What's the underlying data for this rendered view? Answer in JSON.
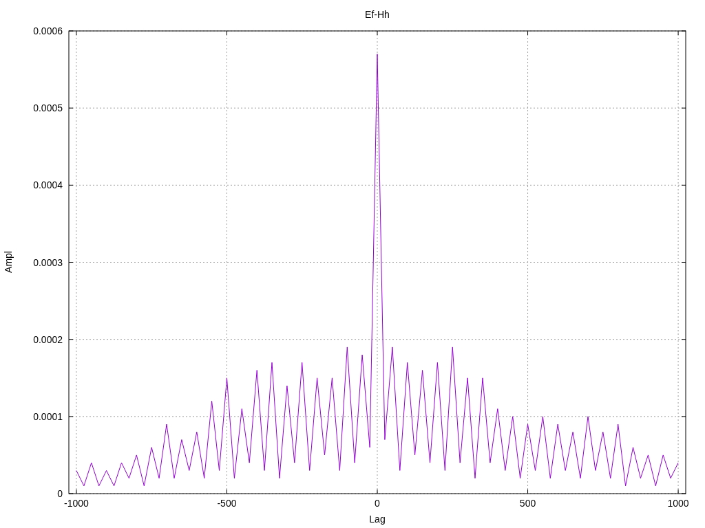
{
  "chart_data": {
    "type": "line",
    "grid": true,
    "title": "Ef-Hh",
    "xlabel": "Lag",
    "ylabel": "Ampl",
    "xlim": [
      -1025,
      1025
    ],
    "ylim": [
      0,
      0.0006
    ],
    "xticks": [
      -1000,
      -500,
      0,
      500,
      1000
    ],
    "yticks": [
      {
        "value": 0,
        "label": "0"
      },
      {
        "value": 0.0001,
        "label": "0.0001"
      },
      {
        "value": 0.0002,
        "label": "0.0002"
      },
      {
        "value": 0.0003,
        "label": "0.0003"
      },
      {
        "value": 0.0004,
        "label": "0.0004"
      },
      {
        "value": 0.0005,
        "label": "0.0005"
      },
      {
        "value": 0.0006,
        "label": "0.0006"
      }
    ],
    "x": [
      -1000,
      -975,
      -950,
      -925,
      -900,
      -875,
      -850,
      -825,
      -800,
      -775,
      -750,
      -725,
      -700,
      -675,
      -650,
      -625,
      -600,
      -575,
      -550,
      -525,
      -500,
      -475,
      -450,
      -425,
      -400,
      -375,
      -350,
      -325,
      -300,
      -275,
      -250,
      -225,
      -200,
      -175,
      -150,
      -125,
      -100,
      -75,
      -50,
      -25,
      0,
      25,
      50,
      75,
      100,
      125,
      150,
      175,
      200,
      225,
      250,
      275,
      300,
      325,
      350,
      375,
      400,
      425,
      450,
      475,
      500,
      525,
      550,
      575,
      600,
      625,
      650,
      675,
      700,
      725,
      750,
      775,
      800,
      825,
      850,
      875,
      900,
      925,
      950,
      975,
      1000
    ],
    "series": [
      {
        "color": "#9400d3",
        "values": [
          3e-05,
          1e-05,
          4e-05,
          1e-05,
          3e-05,
          1e-05,
          4e-05,
          2e-05,
          5e-05,
          1e-05,
          6e-05,
          2e-05,
          9e-05,
          2e-05,
          7e-05,
          3e-05,
          8e-05,
          2e-05,
          0.00012,
          3e-05,
          0.00015,
          2e-05,
          0.00011,
          4e-05,
          0.00016,
          3e-05,
          0.00017,
          2e-05,
          0.00014,
          4e-05,
          0.00017,
          3e-05,
          0.00015,
          5e-05,
          0.00015,
          3e-05,
          0.00019,
          4e-05,
          0.00018,
          6e-05,
          0.00057,
          7e-05,
          0.00019,
          3e-05,
          0.00017,
          5e-05,
          0.00016,
          4e-05,
          0.00017,
          3e-05,
          0.00019,
          4e-05,
          0.00015,
          2e-05,
          0.00015,
          4e-05,
          0.00011,
          3e-05,
          0.0001,
          2e-05,
          9e-05,
          3e-05,
          0.0001,
          2e-05,
          9e-05,
          3e-05,
          8e-05,
          2e-05,
          0.0001,
          3e-05,
          8e-05,
          2e-05,
          9e-05,
          1e-05,
          6e-05,
          2e-05,
          5e-05,
          1e-05,
          5e-05,
          2e-05,
          4e-05
        ]
      }
    ]
  }
}
